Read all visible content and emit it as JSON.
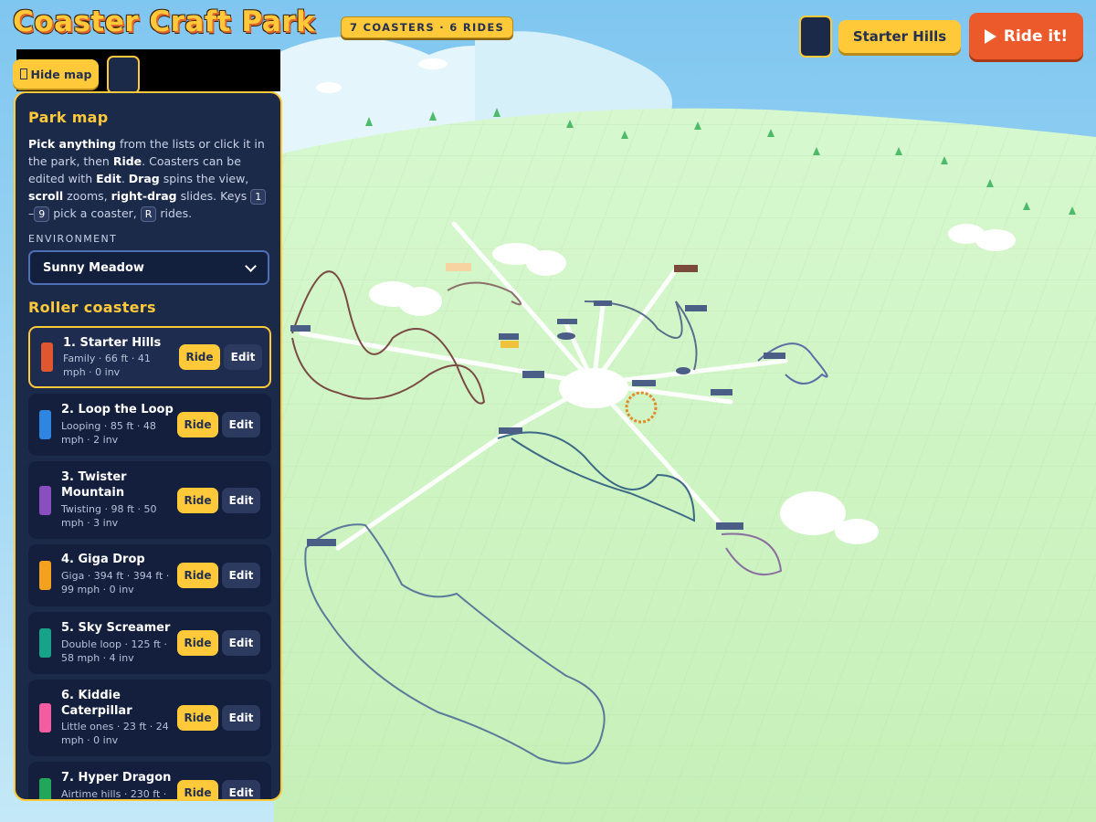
{
  "app": {
    "title": "Coaster Craft Park",
    "counts_badge": "7 COASTERS · 6 RIDES"
  },
  "toolbar": {
    "hide_map_label": "Hide map",
    "current_coaster": "Starter Hills",
    "ride_label": "Ride it!"
  },
  "panel": {
    "heading": "Park map",
    "environment_label": "ENVIRONMENT",
    "environment_value": "Sunny Meadow",
    "coasters_heading": "Roller coasters",
    "ride_button": "Ride",
    "edit_button": "Edit"
  },
  "coasters": [
    {
      "name": "1. Starter Hills",
      "meta": "Family · 66 ft · 41 mph · 0 inv",
      "color": "#e0572f",
      "selected": true
    },
    {
      "name": "2. Loop the Loop",
      "meta": "Looping · 85 ft · 48 mph · 2 inv",
      "color": "#2f86e0",
      "selected": false
    },
    {
      "name": "3. Twister Mountain",
      "meta": "Twisting · 98 ft · 50 mph · 3 inv",
      "color": "#8a4fbf",
      "selected": false
    },
    {
      "name": "4. Giga Drop",
      "meta": "Giga · 394 ft · 394 ft · 99 mph · 0 inv",
      "color": "#f2a21e",
      "selected": false
    },
    {
      "name": "5. Sky Screamer",
      "meta": "Double loop · 125 ft · 58 mph · 4 inv",
      "color": "#17a38a",
      "selected": false
    },
    {
      "name": "6. Kiddie Caterpillar",
      "meta": "Little ones · 23 ft · 24 mph · 0 inv",
      "color": "#f25ca0",
      "selected": false
    },
    {
      "name": "7. Hyper Dragon",
      "meta": "Airtime hills · 230 ft ·",
      "color": "#22a65a",
      "selected": false
    }
  ]
}
